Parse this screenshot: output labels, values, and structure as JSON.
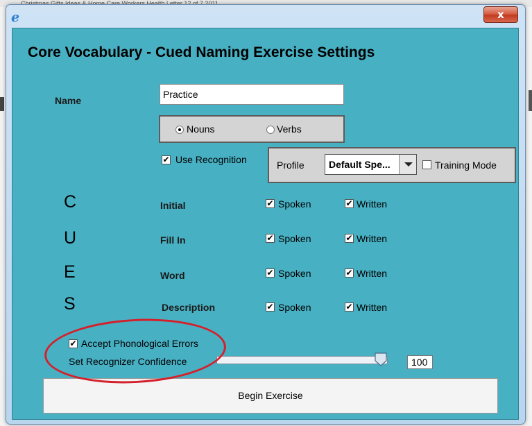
{
  "background": {
    "caption_fragment": "Christmas Gifts Ideas & Home Care Workers Health Letter 12 of 7 2011"
  },
  "window": {
    "close_glyph": "x",
    "app_icon": "ie-icon"
  },
  "dialog": {
    "title": "Core Vocabulary - Cued Naming Exercise Settings",
    "name_label": "Name",
    "name_value": "Practice",
    "word_type": {
      "options": [
        "Nouns",
        "Verbs"
      ],
      "selected": "Nouns"
    },
    "use_recognition": {
      "label": "Use Recognition",
      "checked": true
    },
    "profile": {
      "label": "Profile",
      "value": "Default Spe...",
      "training_mode_label": "Training Mode",
      "training_mode_checked": false
    },
    "cues_letters": [
      "C",
      "U",
      "E",
      "S"
    ],
    "cue_rows": [
      {
        "label": "Initial",
        "spoken_label": "Spoken",
        "written_label": "Written",
        "spoken": true,
        "written": true
      },
      {
        "label": "Fill In",
        "spoken_label": "Spoken",
        "written_label": "Written",
        "spoken": true,
        "written": true
      },
      {
        "label": "Word",
        "spoken_label": "Spoken",
        "written_label": "Written",
        "spoken": true,
        "written": true
      },
      {
        "label": "Description",
        "spoken_label": "Spoken",
        "written_label": "Written",
        "spoken": true,
        "written": true
      }
    ],
    "accept_phonological": {
      "label": "Accept Phonological Errors",
      "checked": true
    },
    "confidence": {
      "label": "Set Recognizer Confidence",
      "value": "100",
      "level_fraction": 1.0
    },
    "begin_button": "Begin Exercise"
  },
  "colors": {
    "panel": "#48b0c3",
    "highlight_ellipse": "#d4202a"
  }
}
